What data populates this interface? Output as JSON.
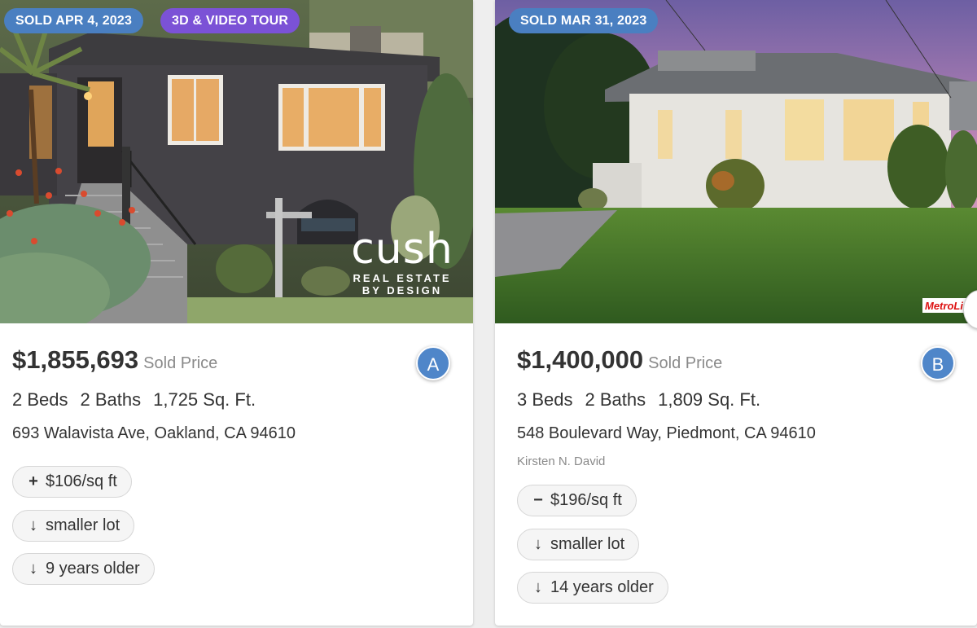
{
  "listings": [
    {
      "sold_badge": "SOLD APR 4, 2023",
      "tour_badge": "3D & VIDEO TOUR",
      "watermark": {
        "brand": "cush",
        "line1": "REAL ESTATE",
        "line2": "BY DESIGN"
      },
      "price": "$1,855,693",
      "price_label": "Sold Price",
      "marker": "A",
      "beds": "2 Beds",
      "baths": "2 Baths",
      "sqft": "1,725 Sq. Ft.",
      "address": "693 Walavista Ave, Oakland, CA 94610",
      "chips": [
        {
          "icon": "plus-icon",
          "glyph": "+",
          "label": "$106/sq ft"
        },
        {
          "icon": "arrow-down-icon",
          "glyph": "↓",
          "label": "smaller lot"
        },
        {
          "icon": "arrow-down-icon",
          "glyph": "↓",
          "label": "9 years older"
        }
      ]
    },
    {
      "sold_badge": "SOLD MAR 31, 2023",
      "watermark": {
        "brand": "MetroLi"
      },
      "price": "$1,400,000",
      "price_label": "Sold Price",
      "marker": "B",
      "beds": "3 Beds",
      "baths": "2 Baths",
      "sqft": "1,809 Sq. Ft.",
      "address": "548 Boulevard Way, Piedmont, CA 94610",
      "agent": "Kirsten N. David",
      "chips": [
        {
          "icon": "minus-icon",
          "glyph": "−",
          "label": "$196/sq ft"
        },
        {
          "icon": "arrow-down-icon",
          "glyph": "↓",
          "label": "smaller lot"
        },
        {
          "icon": "arrow-down-icon",
          "glyph": "↓",
          "label": "14 years older"
        }
      ]
    }
  ],
  "colors": {
    "sold_badge": "#4a7fc1",
    "tour_badge": "#7b52d6",
    "marker": "#4f86c9"
  }
}
